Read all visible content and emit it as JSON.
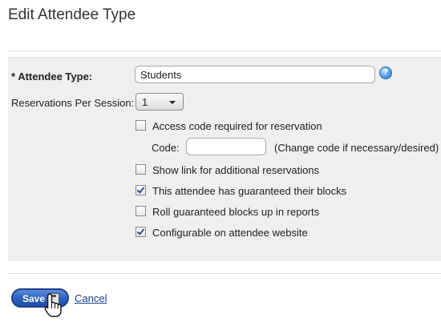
{
  "page": {
    "title": "Edit Attendee Type"
  },
  "form": {
    "attendee_type": {
      "label": "* Attendee Type:",
      "value": "Students",
      "help_icon": "help-icon"
    },
    "reservations_per_session": {
      "label": "Reservations Per Session:",
      "selected": "1"
    },
    "access_code_required": {
      "label": "Access code required for reservation",
      "checked": false
    },
    "code": {
      "label": "Code:",
      "value": "",
      "hint": "(Change code if necessary/desired)"
    },
    "show_link": {
      "label": "Show link for additional reservations",
      "checked": false
    },
    "guaranteed_blocks": {
      "label": "This attendee has guaranteed their blocks",
      "checked": true
    },
    "roll_up": {
      "label": "Roll guaranteed blocks up in reports",
      "checked": false
    },
    "configurable": {
      "label": "Configurable on attendee website",
      "checked": true
    }
  },
  "actions": {
    "save_label": "Save",
    "cancel_label": "Cancel"
  },
  "colors": {
    "save_button": "#2b5fbf",
    "link": "#1a3d8f",
    "panel": "#efefef"
  }
}
